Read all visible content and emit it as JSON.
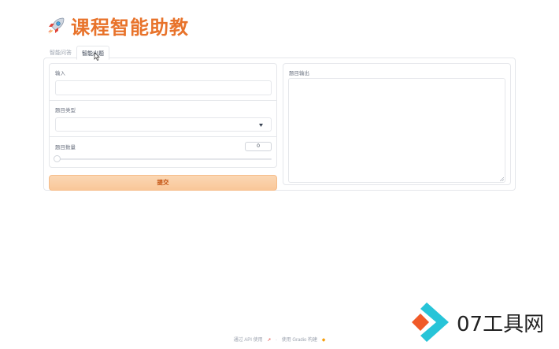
{
  "header": {
    "title": "课程智能助教"
  },
  "tabs": [
    {
      "label": "智能问答",
      "active": false
    },
    {
      "label": "智能出题",
      "active": true
    }
  ],
  "form": {
    "input_label": "输入",
    "input_value": "",
    "type_label": "题目类型",
    "type_value": "",
    "count_label": "题目数量",
    "count_value": "0",
    "submit_label": "提交"
  },
  "output": {
    "label": "题目输出",
    "value": ""
  },
  "footer": {
    "api_text": "通过 API 使用",
    "separator": "·",
    "built_text": "使用 Gradio 构建"
  },
  "watermark": {
    "text": "07工具网"
  },
  "colors": {
    "accent": "#e8732b",
    "button": "#f9c799"
  },
  "icons": [
    "rocket-icon",
    "cursor-icon",
    "resize-icon",
    "chevron-down-icon"
  ]
}
